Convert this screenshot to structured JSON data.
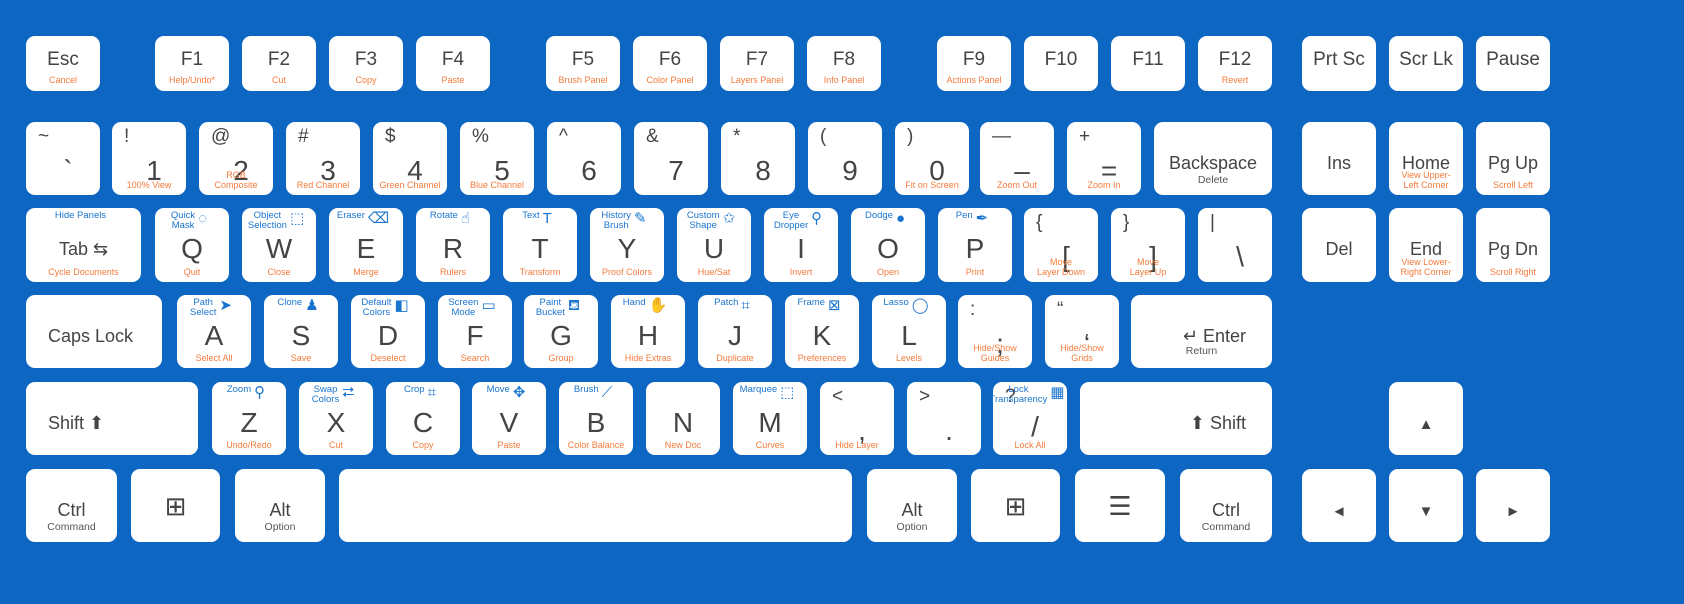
{
  "colors": {
    "background": "#0c66c2",
    "key": "#ffffff",
    "label": "#444444",
    "shortcut": "#f47b3c",
    "tool": "#1a75cf"
  },
  "rows": [
    [
      {
        "main": "Esc",
        "action": "Cancel"
      },
      {
        "main": "F1",
        "action": "Help/Undo*"
      },
      {
        "main": "F2",
        "action": "Cut"
      },
      {
        "main": "F3",
        "action": "Copy"
      },
      {
        "main": "F4",
        "action": "Paste"
      },
      {
        "main": "F5",
        "action": "Brush Panel"
      },
      {
        "main": "F6",
        "action": "Color Panel"
      },
      {
        "main": "F7",
        "action": "Layers Panel"
      },
      {
        "main": "F8",
        "action": "Info Panel"
      },
      {
        "main": "F9",
        "action": "Actions Panel"
      },
      {
        "main": "F10"
      },
      {
        "main": "F11"
      },
      {
        "main": "F12",
        "action": "Revert"
      },
      {
        "main": "Prt Sc"
      },
      {
        "main": "Scr Lk"
      },
      {
        "main": "Pause"
      }
    ],
    [
      {
        "main": "`",
        "shift": "~"
      },
      {
        "main": "1",
        "shift": "!",
        "action": "100% View"
      },
      {
        "main": "2",
        "shift": "@",
        "action": "RGB\nComposite"
      },
      {
        "main": "3",
        "shift": "#",
        "action": "Red Channel"
      },
      {
        "main": "4",
        "shift": "$",
        "action": "Green Channel"
      },
      {
        "main": "5",
        "shift": "%",
        "action": "Blue Channel"
      },
      {
        "main": "6",
        "shift": "^"
      },
      {
        "main": "7",
        "shift": "&"
      },
      {
        "main": "8",
        "shift": "*"
      },
      {
        "main": "9",
        "shift": "("
      },
      {
        "main": "0",
        "shift": ")",
        "action": "Fit on Screen"
      },
      {
        "main": "–",
        "shift": "—",
        "action": "Zoom Out"
      },
      {
        "main": "=",
        "shift": "+",
        "action": "Zoom In"
      },
      {
        "main": "Backspace",
        "sub": "Delete"
      },
      {
        "main": "Ins"
      },
      {
        "main": "Home",
        "action": "View Upper-\nLeft Corner"
      },
      {
        "main": "Pg Up",
        "action": "Scroll Left"
      }
    ],
    [
      {
        "main": "Tab  ⇆",
        "tool": "Hide Panels",
        "action": "Cycle Documents"
      },
      {
        "main": "Q",
        "tool": "Quick\nMask",
        "icon": "quick-mask-icon",
        "action": "Quit"
      },
      {
        "main": "W",
        "tool": "Object\nSelection",
        "icon": "object-selection-icon",
        "action": "Close"
      },
      {
        "main": "E",
        "tool": "Eraser",
        "icon": "eraser-icon",
        "action": "Merge"
      },
      {
        "main": "R",
        "tool": "Rotate",
        "icon": "rotate-hand-icon",
        "action": "Rulers"
      },
      {
        "main": "T",
        "tool": "Text",
        "icon": "text-icon",
        "action": "Transform"
      },
      {
        "main": "Y",
        "tool": "History\nBrush",
        "icon": "history-brush-icon",
        "action": "Proof Colors"
      },
      {
        "main": "U",
        "tool": "Custom\nShape",
        "icon": "custom-shape-icon",
        "action": "Hue/Sat"
      },
      {
        "main": "I",
        "tool": "Eye\nDropper",
        "icon": "eyedropper-icon",
        "action": "Invert"
      },
      {
        "main": "O",
        "tool": "Dodge",
        "icon": "dodge-icon",
        "action": "Open"
      },
      {
        "main": "P",
        "tool": "Pen",
        "icon": "pen-icon",
        "action": "Print"
      },
      {
        "main": "[",
        "shift": "{",
        "action": "Move\nLayer Down"
      },
      {
        "main": "]",
        "shift": "}",
        "action": "Move\nLayer  Up"
      },
      {
        "main": "\\",
        "shift": "|"
      },
      {
        "main": "Del"
      },
      {
        "main": "End",
        "action": "View Lower-\nRight Corner"
      },
      {
        "main": "Pg Dn",
        "action": "Scroll Right"
      }
    ],
    [
      {
        "main": "Caps Lock"
      },
      {
        "main": "A",
        "tool": "Path\nSelect",
        "icon": "cursor-arrow-icon",
        "action": "Select All"
      },
      {
        "main": "S",
        "tool": "Clone",
        "icon": "clone-stamp-icon",
        "action": "Save"
      },
      {
        "main": "D",
        "tool": "Default\nColors",
        "icon": "default-colors-icon",
        "action": "Deselect"
      },
      {
        "main": "F",
        "tool": "Screen\nMode",
        "icon": "screen-mode-icon",
        "action": "Search"
      },
      {
        "main": "G",
        "tool": "Paint\nBucket",
        "icon": "paint-bucket-icon",
        "action": "Group"
      },
      {
        "main": "H",
        "tool": "Hand",
        "icon": "hand-icon",
        "action": "Hide Extras"
      },
      {
        "main": "J",
        "tool": "Patch",
        "icon": "patch-icon",
        "action": "Duplicate"
      },
      {
        "main": "K",
        "tool": "Frame",
        "icon": "frame-icon",
        "action": "Preferences"
      },
      {
        "main": "L",
        "tool": "Lasso",
        "icon": "lasso-icon",
        "action": "Levels"
      },
      {
        "main": ";",
        "shift": ":",
        "action": "Hide/Show\nGuides"
      },
      {
        "main": "‘",
        "shift": "“",
        "action": "Hide/Show\nGrids"
      },
      {
        "main": "↵  Enter",
        "sub": "Return"
      }
    ],
    [
      {
        "main": "Shift  ⬆"
      },
      {
        "main": "Z",
        "tool": "Zoom",
        "icon": "zoom-icon",
        "action": "Undo/Redo"
      },
      {
        "main": "X",
        "tool": "Swap\nColors",
        "icon": "swap-colors-icon",
        "action": "Cut"
      },
      {
        "main": "C",
        "tool": "Crop",
        "icon": "crop-icon",
        "action": "Copy"
      },
      {
        "main": "V",
        "tool": "Move",
        "icon": "move-icon",
        "action": "Paste"
      },
      {
        "main": "B",
        "tool": "Brush",
        "icon": "brush-icon",
        "action": "Color Balance"
      },
      {
        "main": "N",
        "action": "New Doc"
      },
      {
        "main": "M",
        "tool": "Marquee",
        "icon": "marquee-icon",
        "action": "Curves"
      },
      {
        "main": ",",
        "shift": "<",
        "action": "Hide Layer"
      },
      {
        "main": ".",
        "shift": ">"
      },
      {
        "main": "/",
        "shift": "?",
        "tool": "Lock\nTransparency",
        "icon": "checker-icon",
        "action": "Lock All"
      },
      {
        "main": "⬆  Shift"
      },
      {
        "main": "▲"
      }
    ],
    [
      {
        "main": "Ctrl",
        "sub": "Command"
      },
      {
        "main": "⊞",
        "icon": "windows-icon"
      },
      {
        "main": "Alt",
        "sub": "Option"
      },
      {
        "main": ""
      },
      {
        "main": "Alt",
        "sub": "Option"
      },
      {
        "main": "⊞",
        "icon": "windows-icon"
      },
      {
        "main": "☰",
        "icon": "menu-icon"
      },
      {
        "main": "Ctrl",
        "sub": "Command"
      },
      {
        "main": "◄"
      },
      {
        "main": "▼"
      },
      {
        "main": "►"
      }
    ]
  ]
}
